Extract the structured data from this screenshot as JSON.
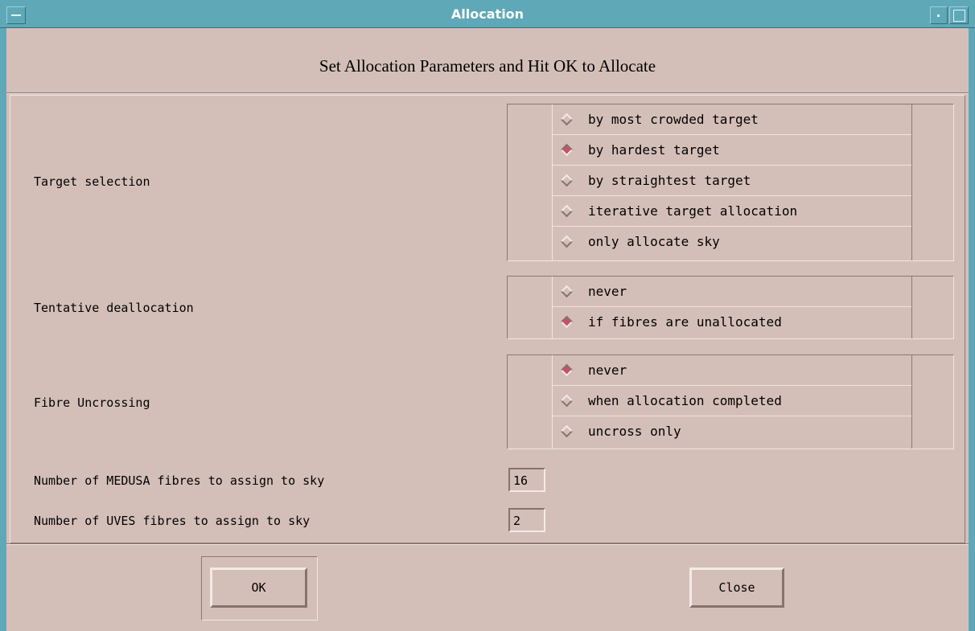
{
  "window": {
    "title": "Allocation"
  },
  "heading": "Set Allocation Parameters and Hit OK to Allocate",
  "target_selection": {
    "label": "Target selection",
    "options": [
      {
        "label": "by most crowded target",
        "selected": false
      },
      {
        "label": "by hardest target",
        "selected": true
      },
      {
        "label": "by straightest target",
        "selected": false
      },
      {
        "label": "iterative target allocation",
        "selected": false
      },
      {
        "label": "only allocate sky",
        "selected": false
      }
    ]
  },
  "tentative_deallocation": {
    "label": "Tentative deallocation",
    "options": [
      {
        "label": "never",
        "selected": false
      },
      {
        "label": "if fibres are unallocated",
        "selected": true
      }
    ]
  },
  "fibre_uncrossing": {
    "label": "Fibre Uncrossing",
    "options": [
      {
        "label": "never",
        "selected": true
      },
      {
        "label": "when allocation completed",
        "selected": false
      },
      {
        "label": "uncross only",
        "selected": false
      }
    ]
  },
  "medusa_sky": {
    "label": "Number of MEDUSA fibres to assign to sky",
    "value": "16"
  },
  "uves_sky": {
    "label": "Number of UVES fibres to assign to sky",
    "value": "2"
  },
  "buttons": {
    "ok": "OK",
    "close": "Close"
  },
  "colors": {
    "background": "#d4bfb8",
    "titlebar": "#5fa8b8",
    "radio_selected": "#c8506a"
  }
}
